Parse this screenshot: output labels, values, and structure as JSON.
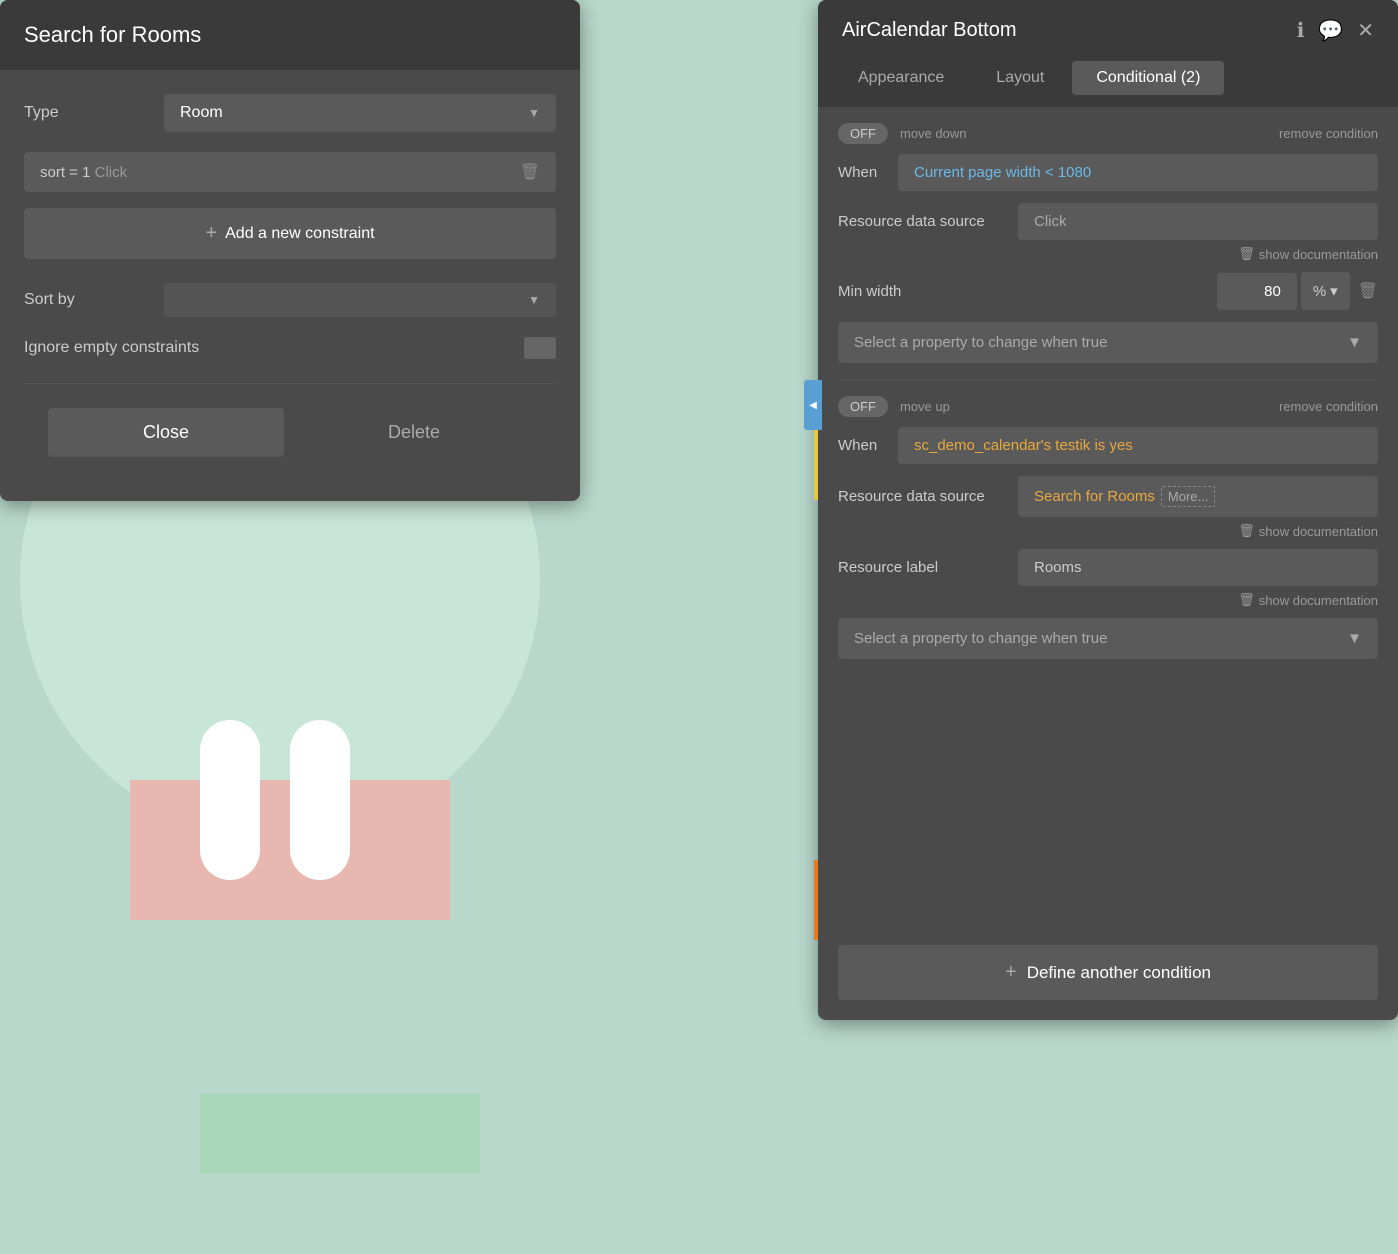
{
  "leftPanel": {
    "title": "Search for Rooms",
    "typeLabel": "Type",
    "typeValue": "Room",
    "constraintText": "sort = 1",
    "constraintClick": "Click",
    "addConstraintLabel": "+ Add a new constraint",
    "sortByLabel": "Sort by",
    "ignoreEmptyLabel": "Ignore empty constraints",
    "closeLabel": "Close",
    "deleteLabel": "Delete"
  },
  "rightPanel": {
    "title": "AirCalendar Bottom",
    "tabs": [
      {
        "label": "Appearance",
        "active": false
      },
      {
        "label": "Layout",
        "active": false
      },
      {
        "label": "Conditional (2)",
        "active": true
      }
    ],
    "condition1": {
      "offLabel": "OFF",
      "moveDownLabel": "move down",
      "removeLabel": "remove condition",
      "whenLabel": "When",
      "whenValue": "Current page width < 1080",
      "resourceLabel": "Resource data source",
      "resourceValue": "Click",
      "showDocLabel": "show documentation",
      "minWidthLabel": "Min width",
      "minWidthValue": "80",
      "minWidthUnit": "%",
      "selectPropertyLabel": "Select a property to change when true"
    },
    "condition2": {
      "offLabel": "OFF",
      "moveUpLabel": "move up",
      "removeLabel": "remove condition",
      "whenLabel": "When",
      "whenValue": "sc_demo_calendar's testik is yes",
      "resourceLabel": "Resource data source",
      "resourceValueOrange": "Search for Rooms",
      "resourceValueMore": "More...",
      "showDocLabel": "show documentation",
      "resourceLabelLabel": "Resource label",
      "resourceLabelValue": "Rooms",
      "showDocLabel2": "show documentation",
      "selectPropertyLabel": "Select a property to change when true"
    },
    "defineAnotherLabel": "+ Define another condition"
  }
}
